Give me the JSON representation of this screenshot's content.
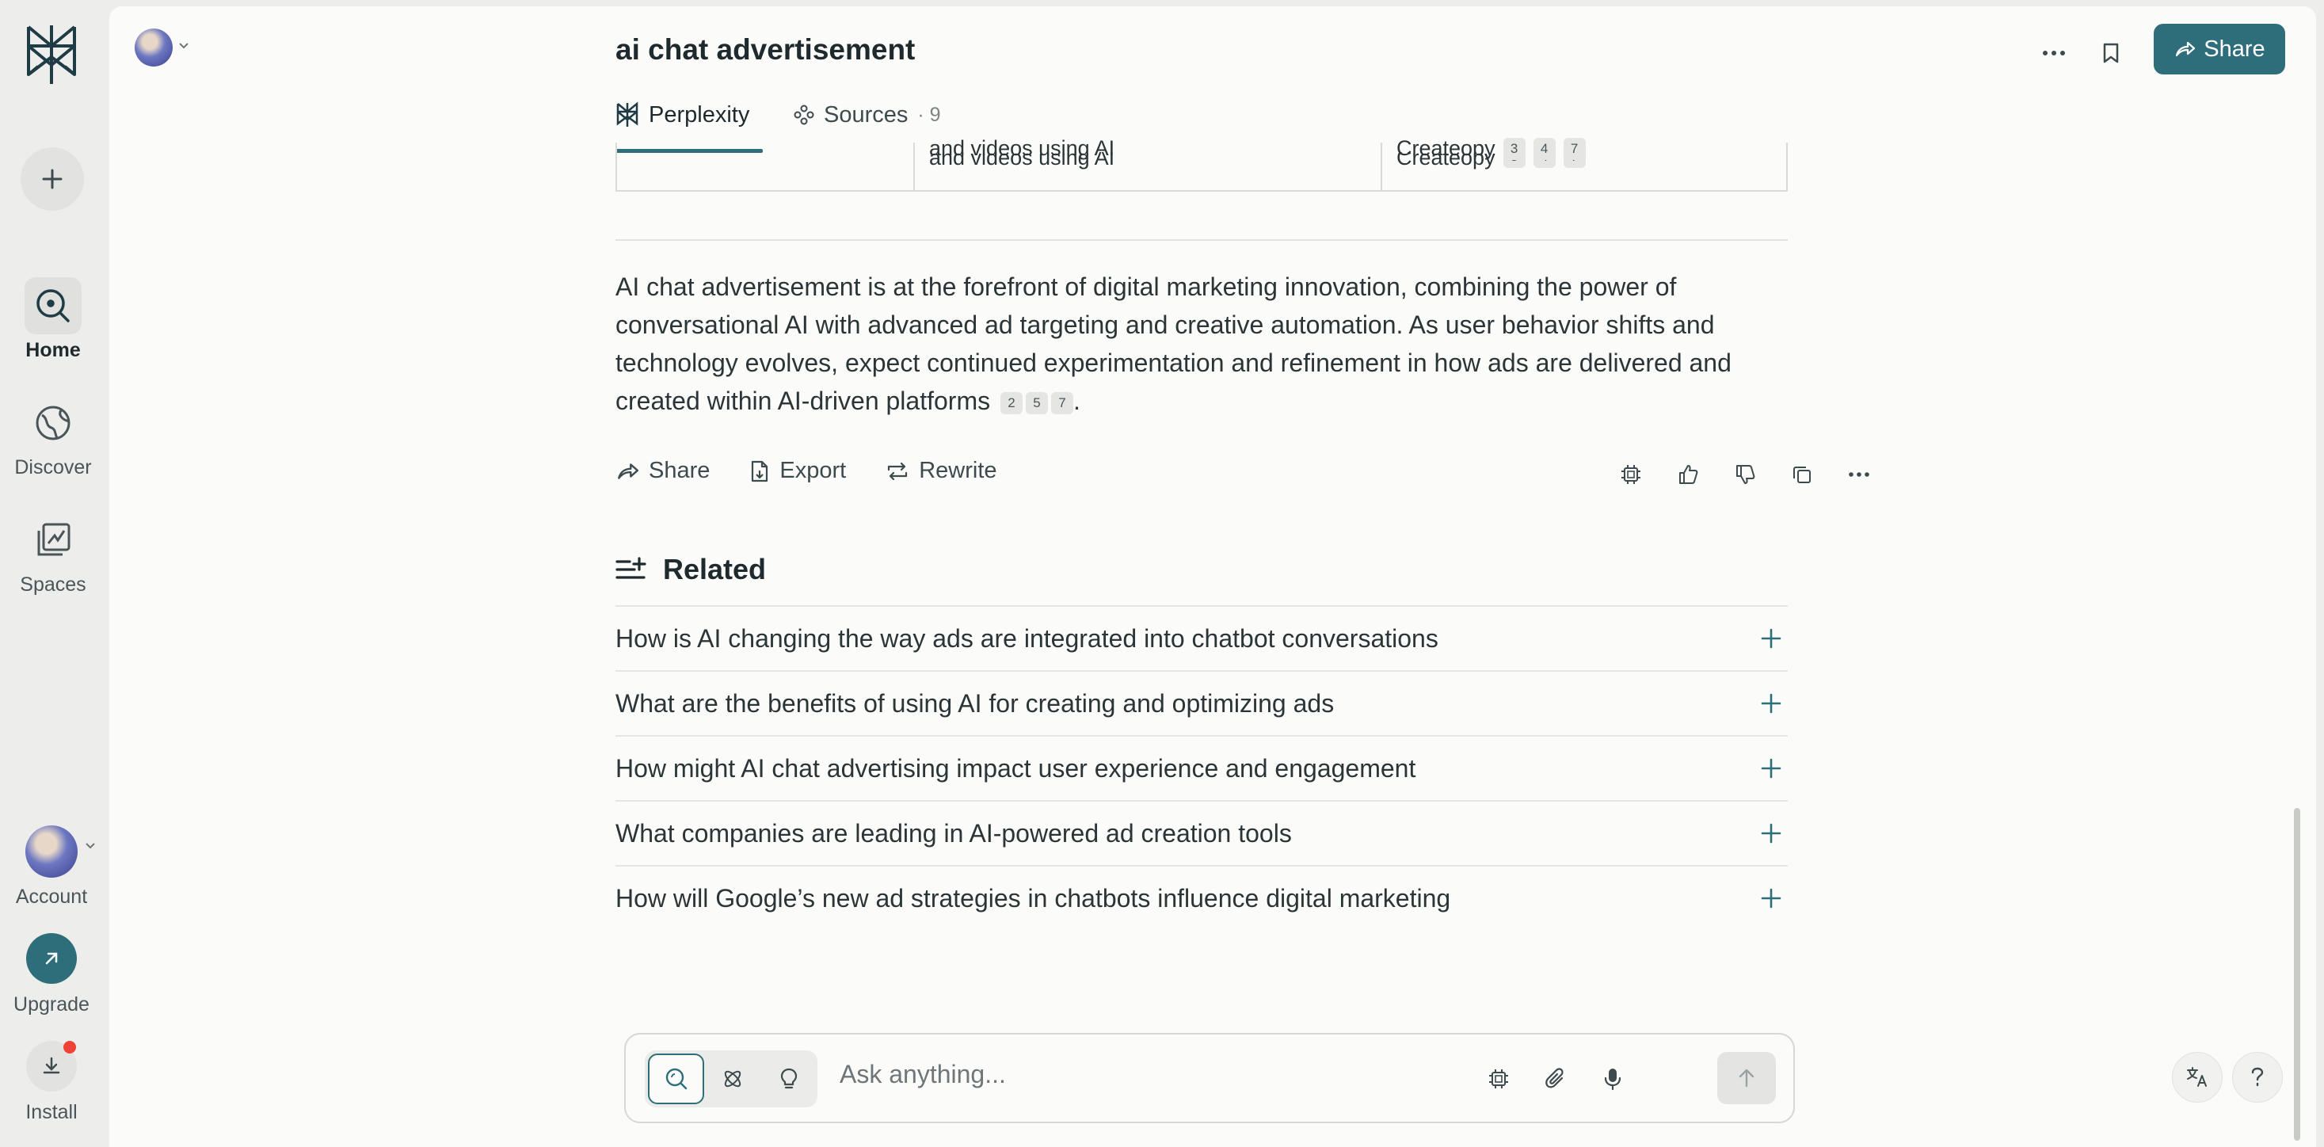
{
  "rail": {
    "items": [
      {
        "label": "Home",
        "icon": "search-circle-icon",
        "active": true
      },
      {
        "label": "Discover",
        "icon": "globe-icon",
        "active": false
      },
      {
        "label": "Spaces",
        "icon": "spaces-icon",
        "active": false
      }
    ],
    "account_label": "Account",
    "upgrade_label": "Upgrade",
    "install_label": "Install"
  },
  "header": {
    "title": "ai chat advertisement",
    "share_label": "Share"
  },
  "tabs": {
    "perplexity_label": "Perplexity",
    "sources_label": "Sources",
    "sources_count": "· 9"
  },
  "table_fragment": {
    "cells": [
      "",
      "and videos using AI",
      "Createopy"
    ],
    "citations": [
      "3",
      "4",
      "7"
    ]
  },
  "answer": {
    "paragraph": "AI chat advertisement is at the forefront of digital marketing innovation, combining the power of conversational AI with advanced ad targeting and creative automation. As user behavior shifts and technology evolves, expect continued experimentation and refinement in how ads are delivered and created within AI-driven platforms",
    "citations": [
      "2",
      "5",
      "7"
    ],
    "end_punct": "."
  },
  "actions": {
    "share": "Share",
    "export": "Export",
    "rewrite": "Rewrite"
  },
  "related": {
    "heading": "Related",
    "items": [
      "How is AI changing the way ads are integrated into chatbot conversations",
      "What are the benefits of using AI for creating and optimizing ads",
      "How might AI chat advertising impact user experience and engagement",
      "What companies are leading in AI-powered ad creation tools",
      "How will Google’s new ad strategies in chatbots influence digital marketing"
    ]
  },
  "ask_bar": {
    "placeholder": "Ask anything..."
  },
  "colors": {
    "accent": "#2e6e7b",
    "rail_bg": "#ededeb",
    "panel_bg": "#fbfbf9",
    "notification": "#ee4237"
  }
}
